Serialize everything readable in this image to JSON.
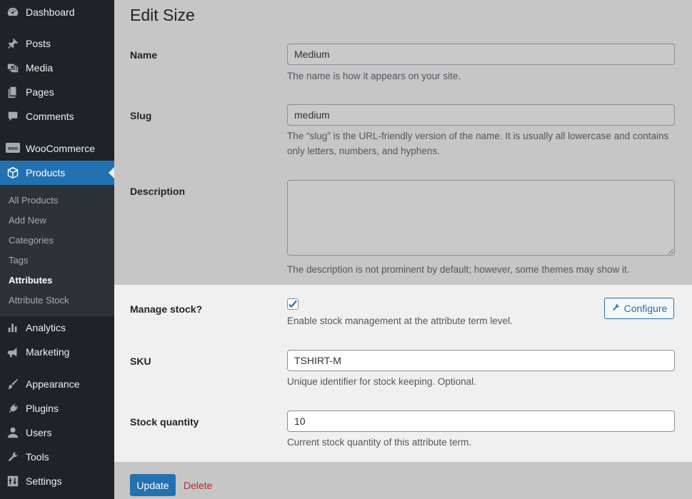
{
  "sidebar": {
    "menu": [
      {
        "label": "Dashboard",
        "icon": "dashboard-icon"
      },
      {
        "label": "Posts",
        "icon": "pin-icon"
      },
      {
        "label": "Media",
        "icon": "media-icon"
      },
      {
        "label": "Pages",
        "icon": "pages-icon"
      },
      {
        "label": "Comments",
        "icon": "comment-icon"
      },
      {
        "label": "WooCommerce",
        "icon": "woo-icon"
      },
      {
        "label": "Products",
        "icon": "box-icon"
      },
      {
        "label": "Analytics",
        "icon": "bar-chart-icon"
      },
      {
        "label": "Marketing",
        "icon": "megaphone-icon"
      },
      {
        "label": "Appearance",
        "icon": "brush-icon"
      },
      {
        "label": "Plugins",
        "icon": "plug-icon"
      },
      {
        "label": "Users",
        "icon": "user-icon"
      },
      {
        "label": "Tools",
        "icon": "wrench-icon"
      },
      {
        "label": "Settings",
        "icon": "sliders-icon"
      }
    ],
    "submenu": [
      {
        "label": "All Products"
      },
      {
        "label": "Add New"
      },
      {
        "label": "Categories"
      },
      {
        "label": "Tags"
      },
      {
        "label": "Attributes"
      },
      {
        "label": "Attribute Stock"
      }
    ],
    "woo_badge": "woo"
  },
  "page": {
    "title": "Edit Size",
    "name": {
      "label": "Name",
      "value": "Medium",
      "help": "The name is how it appears on your site."
    },
    "slug": {
      "label": "Slug",
      "value": "medium",
      "help": "The “slug” is the URL-friendly version of the name. It is usually all lowercase and contains only letters, numbers, and hyphens."
    },
    "description": {
      "label": "Description",
      "value": "",
      "help": "The description is not prominent by default; however, some themes may show it."
    },
    "manage_stock": {
      "label": "Manage stock?",
      "checked": true,
      "help": "Enable stock management at the attribute term level.",
      "configure_label": "Configure"
    },
    "sku": {
      "label": "SKU",
      "value": "TSHIRT-M",
      "help": "Unique identifier for stock keeping. Optional."
    },
    "stock_quantity": {
      "label": "Stock quantity",
      "value": "10",
      "help": "Current stock quantity of this attribute term."
    },
    "update_label": "Update",
    "delete_label": "Delete"
  },
  "colors": {
    "sidebar_bg": "#1d2327",
    "submenu_bg": "#2c3338",
    "accent": "#2271b1",
    "delete": "#b32d2e",
    "overlay_bg": "#c6c6c6",
    "panel_bg": "#f0f0f1"
  }
}
